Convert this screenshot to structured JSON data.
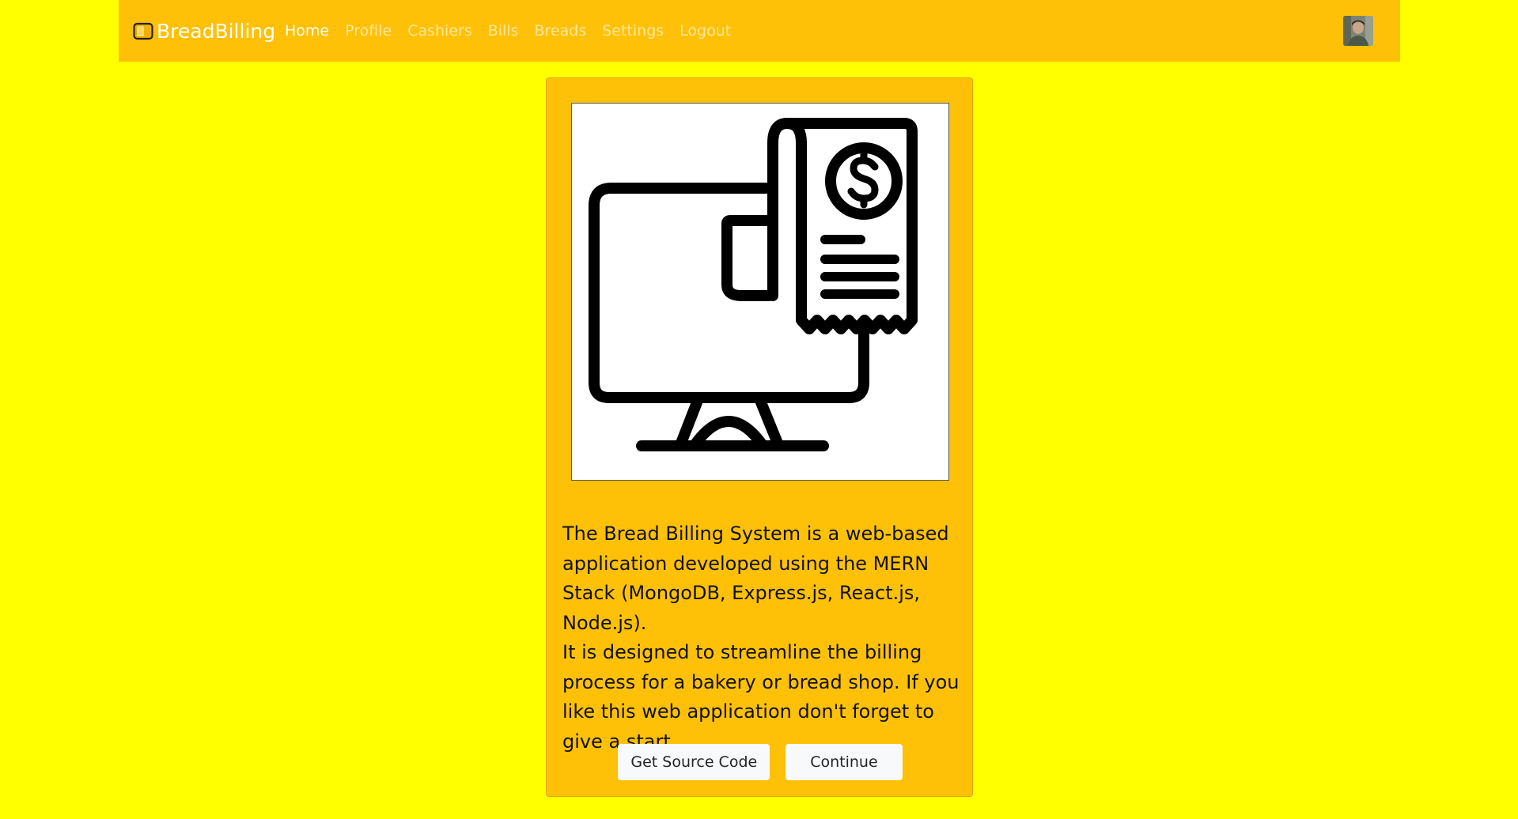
{
  "navbar": {
    "brand": "BreadBilling",
    "links": [
      {
        "label": "Home",
        "active": true
      },
      {
        "label": "Profile",
        "active": false
      },
      {
        "label": "Cashiers",
        "active": false
      },
      {
        "label": "Bills",
        "active": false
      },
      {
        "label": "Breads",
        "active": false
      },
      {
        "label": "Settings",
        "active": false
      },
      {
        "label": "Logout",
        "active": false
      }
    ],
    "background_color": "#ffc107"
  },
  "card": {
    "image_icon": "computer-bill-icon",
    "paragraph1": "The Bread Billing System is a web-based application developed using the MERN Stack (MongoDB, Express.js, React.js, Node.js).",
    "paragraph2": "It is designed to streamline the billing process for a bakery or bread shop. If you like this web application don't forget to give a start.",
    "buttons": {
      "source_code": "Get Source Code",
      "continue": "Continue"
    }
  },
  "colors": {
    "page_background": "#ffff00",
    "card_background": "#ffc107"
  }
}
